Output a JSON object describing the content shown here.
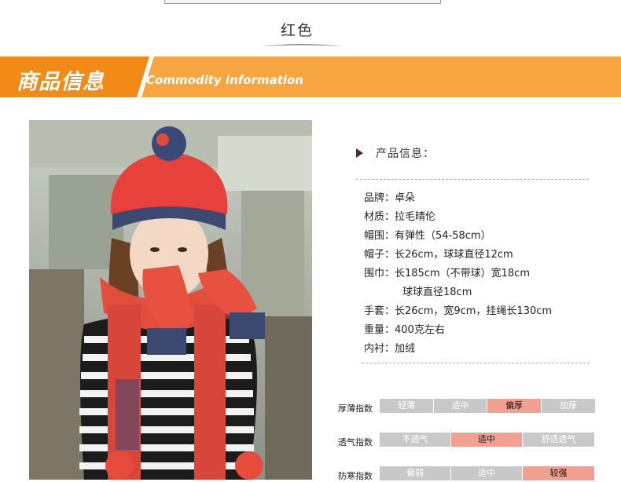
{
  "header": {
    "color_label": "红色"
  },
  "banner": {
    "title": "商品信息",
    "subtitle": "Commodity information",
    "accent": "#f7941d"
  },
  "info": {
    "heading": "产品信息：",
    "specs": [
      "品牌：卓朵",
      "材质：拉毛晴伦",
      "帽围：有弹性（54-58cm）",
      "帽子：长26cm，球球直径12cm",
      "围巾：长185cm（不带球）宽18cm",
      "球球直径18cm",
      "手套：长26cm，宽9cm，挂绳长130cm",
      "重量：400克左右",
      "内衬：加绒"
    ]
  },
  "ratings": [
    {
      "label": "厚薄指数",
      "options": [
        "轻薄",
        "适中",
        "偏厚",
        "加厚"
      ],
      "selected": "偏厚"
    },
    {
      "label": "透气指数",
      "options": [
        "不透气",
        "适中",
        "舒适透气"
      ],
      "selected": "适中"
    },
    {
      "label": "防寒指数",
      "options": [
        "偏弱",
        "适中",
        "较强"
      ],
      "selected": "较强"
    }
  ],
  "colors": {
    "highlight": "#f2a091",
    "inactive": "#c8c8c8"
  }
}
